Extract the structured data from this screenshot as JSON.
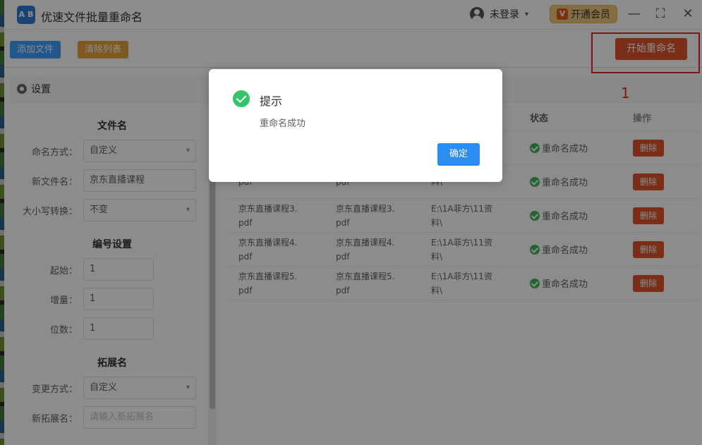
{
  "app": {
    "title": "优速文件批量重命名",
    "logo_text": "A B",
    "user_label": "未登录",
    "vip_mark": "V",
    "vip_label": "开通会员",
    "win_min": "—",
    "win_max": "⛶",
    "win_close": "✕"
  },
  "toolbar": {
    "add_label": "添加文件",
    "clear_label": "清除列表",
    "start_label": "开始重命名"
  },
  "annotation": {
    "number": "1"
  },
  "settings": {
    "title": "设置",
    "filename_section": "文件名",
    "naming_mode_label": "命名方式：",
    "naming_mode_value": "自定义",
    "new_name_label": "新文件名：",
    "new_name_value": "京东直播课程",
    "case_label": "大小写转换：",
    "case_value": "不变",
    "numbering_section": "编号设置",
    "start_label": "起始：",
    "start_value": "1",
    "step_label": "增量：",
    "step_value": "1",
    "digits_label": "位数：",
    "digits_value": "1",
    "ext_section": "拓展名",
    "ext_mode_label": "变更方式：",
    "ext_mode_value": "自定义",
    "new_ext_label": "新拓展名：",
    "new_ext_placeholder": "请输入新拓展名"
  },
  "table": {
    "headers": {
      "status": "状态",
      "action": "操作"
    },
    "rows": [
      {
        "orig": "",
        "orig2": "",
        "newname": "",
        "newname2": "",
        "path": "",
        "path2": "",
        "status": "重命名成功",
        "action": "删除"
      },
      {
        "orig": "",
        "orig2": "pdf",
        "newname": "",
        "newname2": "pdf",
        "path": "",
        "path2": "料\\",
        "status": "重命名成功",
        "action": "删除"
      },
      {
        "orig": "京东直播课程3.",
        "orig2": "pdf",
        "newname": "京东直播课程3.",
        "newname2": "pdf",
        "path": "E:\\1A菲方\\11资",
        "path2": "料\\",
        "status": "重命名成功",
        "action": "删除"
      },
      {
        "orig": "京东直播课程4.",
        "orig2": "pdf",
        "newname": "京东直播课程4.",
        "newname2": "pdf",
        "path": "E:\\1A菲方\\11资",
        "path2": "料\\",
        "status": "重命名成功",
        "action": "删除"
      },
      {
        "orig": "京东直播课程5.",
        "orig2": "pdf",
        "newname": "京东直播课程5.",
        "newname2": "pdf",
        "path": "E:\\1A菲方\\11资",
        "path2": "料\\",
        "status": "重命名成功",
        "action": "删除"
      }
    ]
  },
  "dialog": {
    "title": "提示",
    "message": "重命名成功",
    "ok_label": "确定"
  }
}
